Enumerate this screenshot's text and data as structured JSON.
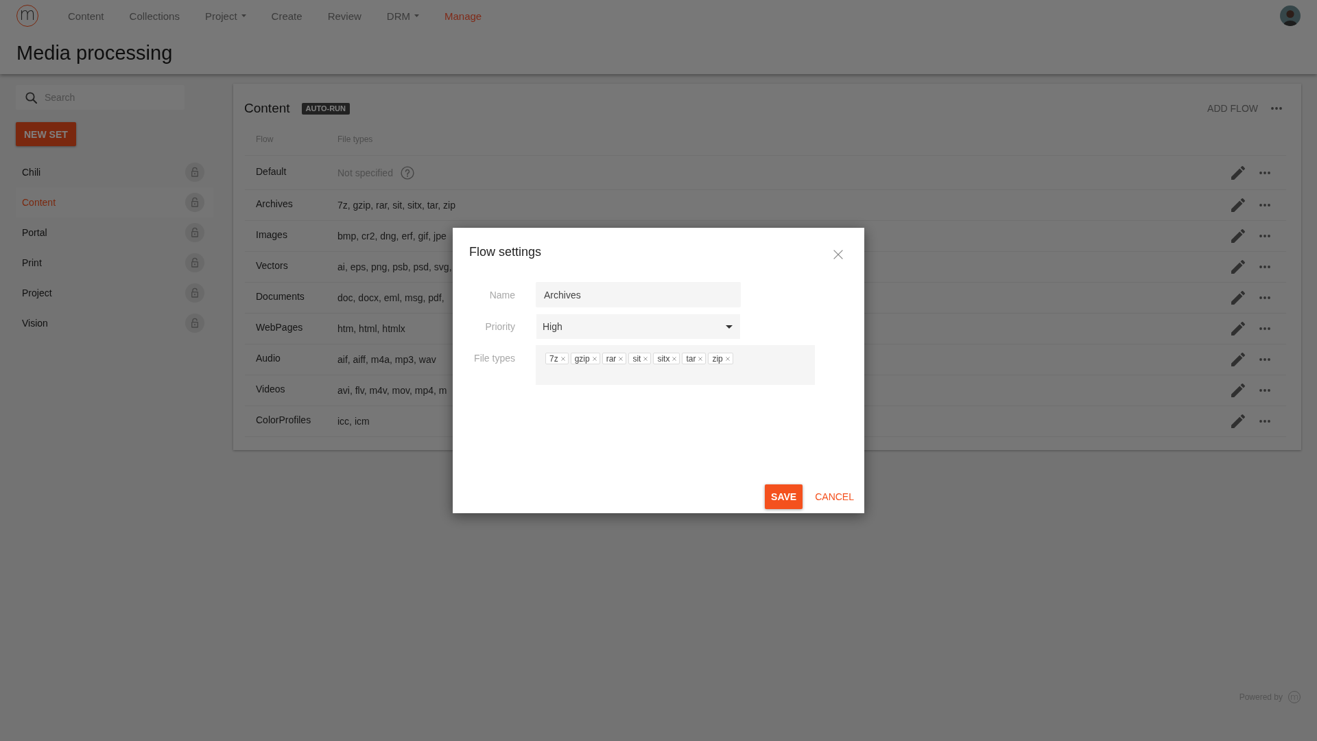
{
  "header": {
    "logo": "m",
    "nav": [
      {
        "label": "Content",
        "dropdown": false,
        "selected": false
      },
      {
        "label": "Collections",
        "dropdown": false,
        "selected": false
      },
      {
        "label": "Project",
        "dropdown": true,
        "selected": false
      },
      {
        "label": "Create",
        "dropdown": false,
        "selected": false
      },
      {
        "label": "Review",
        "dropdown": false,
        "selected": false
      },
      {
        "label": "DRM",
        "dropdown": true,
        "selected": false
      },
      {
        "label": "Manage",
        "dropdown": false,
        "selected": true
      }
    ],
    "title": "Media processing"
  },
  "sidebar": {
    "search": {
      "placeholder": "Search"
    },
    "new_button": "NEW SET",
    "items": [
      {
        "label": "Chili",
        "selected": false
      },
      {
        "label": "Content",
        "selected": true
      },
      {
        "label": "Portal",
        "selected": false
      },
      {
        "label": "Print",
        "selected": false
      },
      {
        "label": "Project",
        "selected": false
      },
      {
        "label": "Vision",
        "selected": false
      }
    ]
  },
  "panel": {
    "title": "Content",
    "badge": "AUTO-RUN",
    "add_button": "ADD FLOW",
    "columns": [
      "Flow",
      "File types"
    ],
    "rows": [
      {
        "flow": "Default",
        "file_types": "Not specified",
        "kind": "unspecified"
      },
      {
        "flow": "Archives",
        "file_types": "7z, gzip, rar, sit, sitx, tar, zip",
        "kind": "list"
      },
      {
        "flow": "Images",
        "file_types": "bmp, cr2, dng, erf, gif, jpe",
        "kind": "list"
      },
      {
        "flow": "Vectors",
        "file_types": "ai, eps, png, psb, psd, svg,",
        "kind": "list"
      },
      {
        "flow": "Documents",
        "file_types": "doc, docx, eml, msg, pdf,",
        "kind": "list"
      },
      {
        "flow": "WebPages",
        "file_types": "htm, html, htmlx",
        "kind": "list"
      },
      {
        "flow": "Audio",
        "file_types": "aif, aiff, m4a, mp3, wav",
        "kind": "list"
      },
      {
        "flow": "Videos",
        "file_types": "avi, flv, m4v, mov, mp4, m",
        "kind": "list"
      },
      {
        "flow": "ColorProfiles",
        "file_types": "icc, icm",
        "kind": "list"
      }
    ]
  },
  "dialog": {
    "title": "Flow settings",
    "fields": [
      {
        "label": "Name",
        "kind": "text",
        "value": "Archives"
      },
      {
        "label": "Priority",
        "kind": "select",
        "value": "High"
      },
      {
        "label": "File types",
        "kind": "tags",
        "tags": [
          "7z",
          "gzip",
          "rar",
          "sit",
          "sitx",
          "tar",
          "zip"
        ]
      }
    ],
    "buttons": [
      {
        "label": "SAVE",
        "kind": "primary"
      },
      {
        "label": "CANCEL",
        "kind": "flat"
      }
    ]
  },
  "footer": {
    "text": "Powered by",
    "logo": "m"
  }
}
